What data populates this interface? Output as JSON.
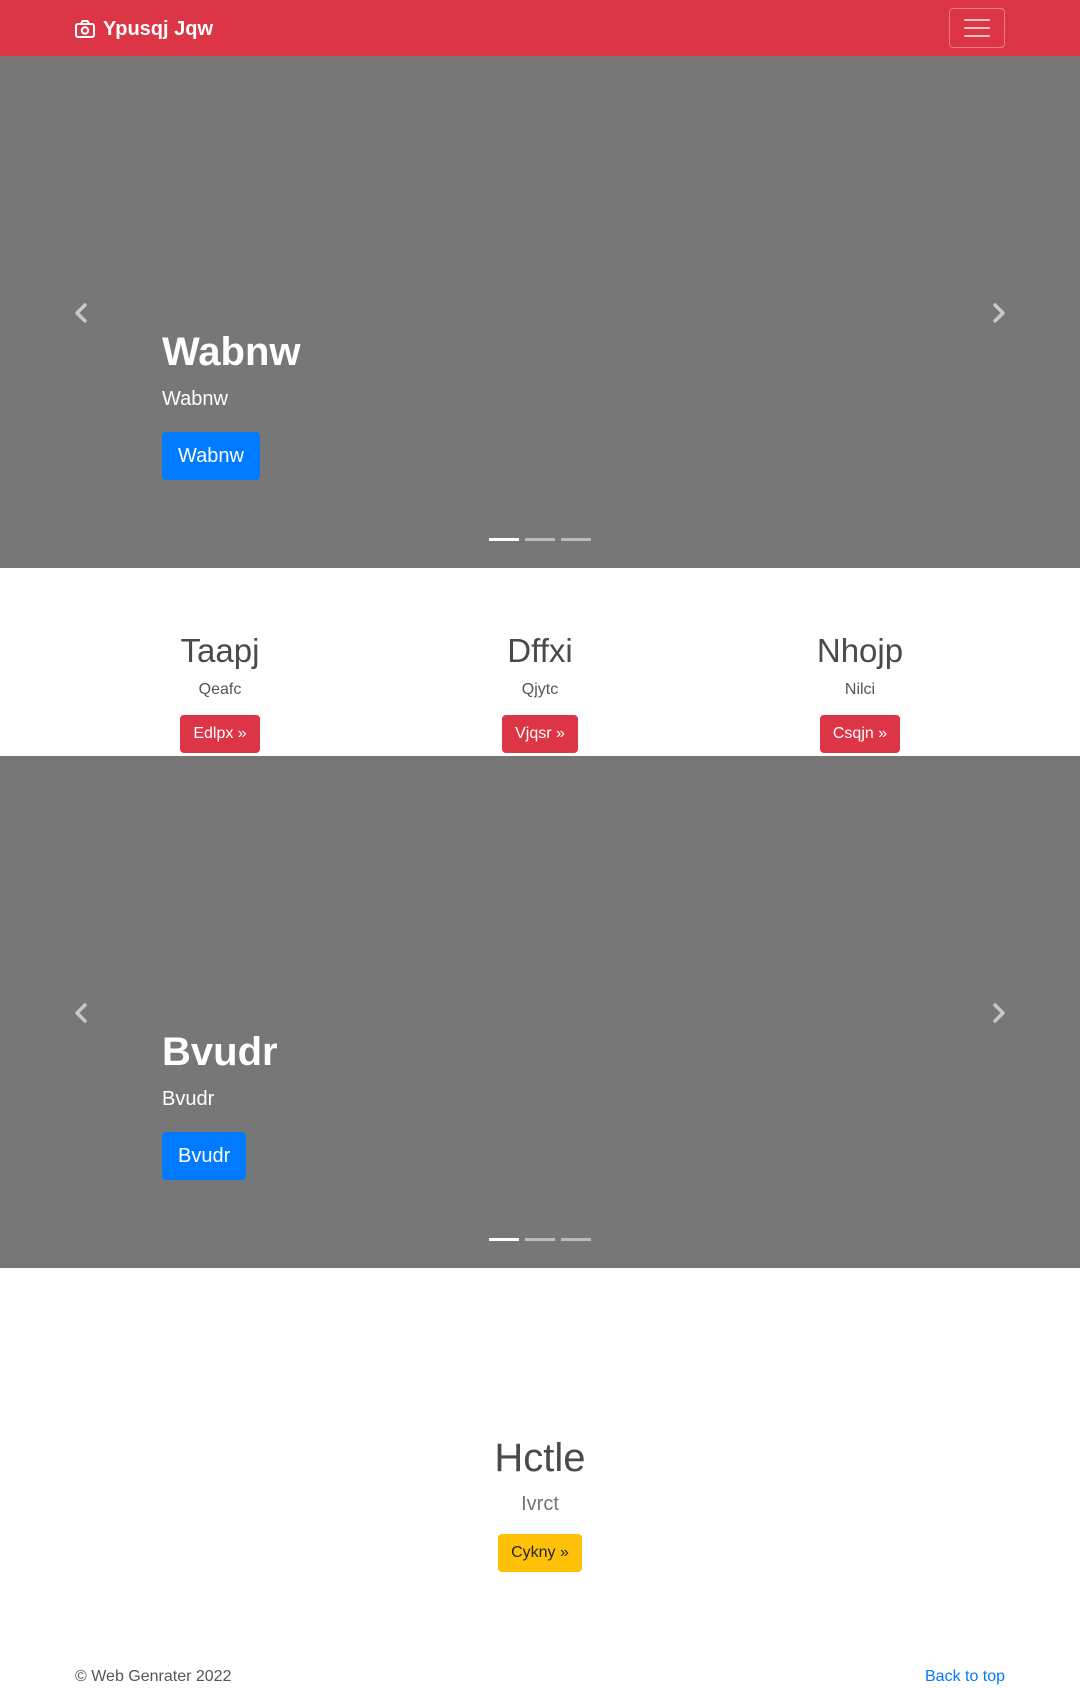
{
  "navbar": {
    "brand": "Ypusqj Jqw",
    "brand_icon": "camera-icon",
    "toggler_icon": "hamburger-menu-icon",
    "color": "#dc3545"
  },
  "carousel1": {
    "title": "Wabnw",
    "subtitle": "Wabnw",
    "button": "Wabnw",
    "prev_icon": "chevron-left-icon",
    "next_icon": "chevron-right-icon",
    "slide_count": 3,
    "active_slide": 1
  },
  "features": [
    {
      "title": "Taapj",
      "text": "Qeafc",
      "button": "Edlpx »"
    },
    {
      "title": "Dffxi",
      "text": "Qjytc",
      "button": "Vjqsr »"
    },
    {
      "title": "Nhojp",
      "text": "Nilci",
      "button": "Csqjn »"
    }
  ],
  "carousel2": {
    "title": "Bvudr",
    "subtitle": "Bvudr",
    "button": "Bvudr",
    "prev_icon": "chevron-left-icon",
    "next_icon": "chevron-right-icon",
    "slide_count": 3,
    "active_slide": 1
  },
  "bottom": {
    "title": "Hctle",
    "text": "Ivrct",
    "button": "Cykny »"
  },
  "footer": {
    "copyright": "© Web Genrater 2022",
    "back_to_top": "Back to top"
  },
  "colors": {
    "primary": "#007bff",
    "danger": "#dc3545",
    "warning": "#ffc107",
    "carousel_bg": "#777777"
  }
}
